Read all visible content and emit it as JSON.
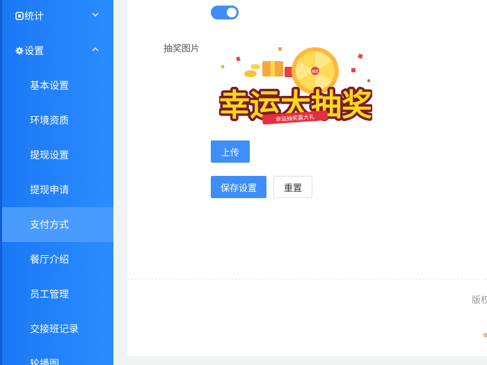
{
  "sidebar": {
    "groups": [
      {
        "label": "统计",
        "icon": "chart-box-icon",
        "chevron": "chevron-down-icon"
      },
      {
        "label": "设置",
        "icon": "gear-icon",
        "chevron": "chevron-up-icon"
      }
    ],
    "items": [
      {
        "label": "基本设置"
      },
      {
        "label": "环境资质"
      },
      {
        "label": "提现设置"
      },
      {
        "label": "提现申请"
      },
      {
        "label": "支付方式",
        "active": true
      },
      {
        "label": "餐厅介绍"
      },
      {
        "label": "员工管理"
      },
      {
        "label": "交接班记录"
      },
      {
        "label": "轮播图"
      }
    ],
    "colors": {
      "background": "#1a78f5",
      "active": "#4a9bff"
    }
  },
  "form": {
    "toggle": {
      "on": true,
      "color": "#3f8ef7"
    },
    "image_label": "抽奖图片",
    "image": {
      "title": "幸运大抽奖",
      "subtitle": "幸运抽奖赢大礼",
      "wheel_center": "抽奖"
    },
    "upload_label": "上传",
    "save_label": "保存设置",
    "reset_label": "重置"
  },
  "footer": {
    "text": "版权"
  }
}
